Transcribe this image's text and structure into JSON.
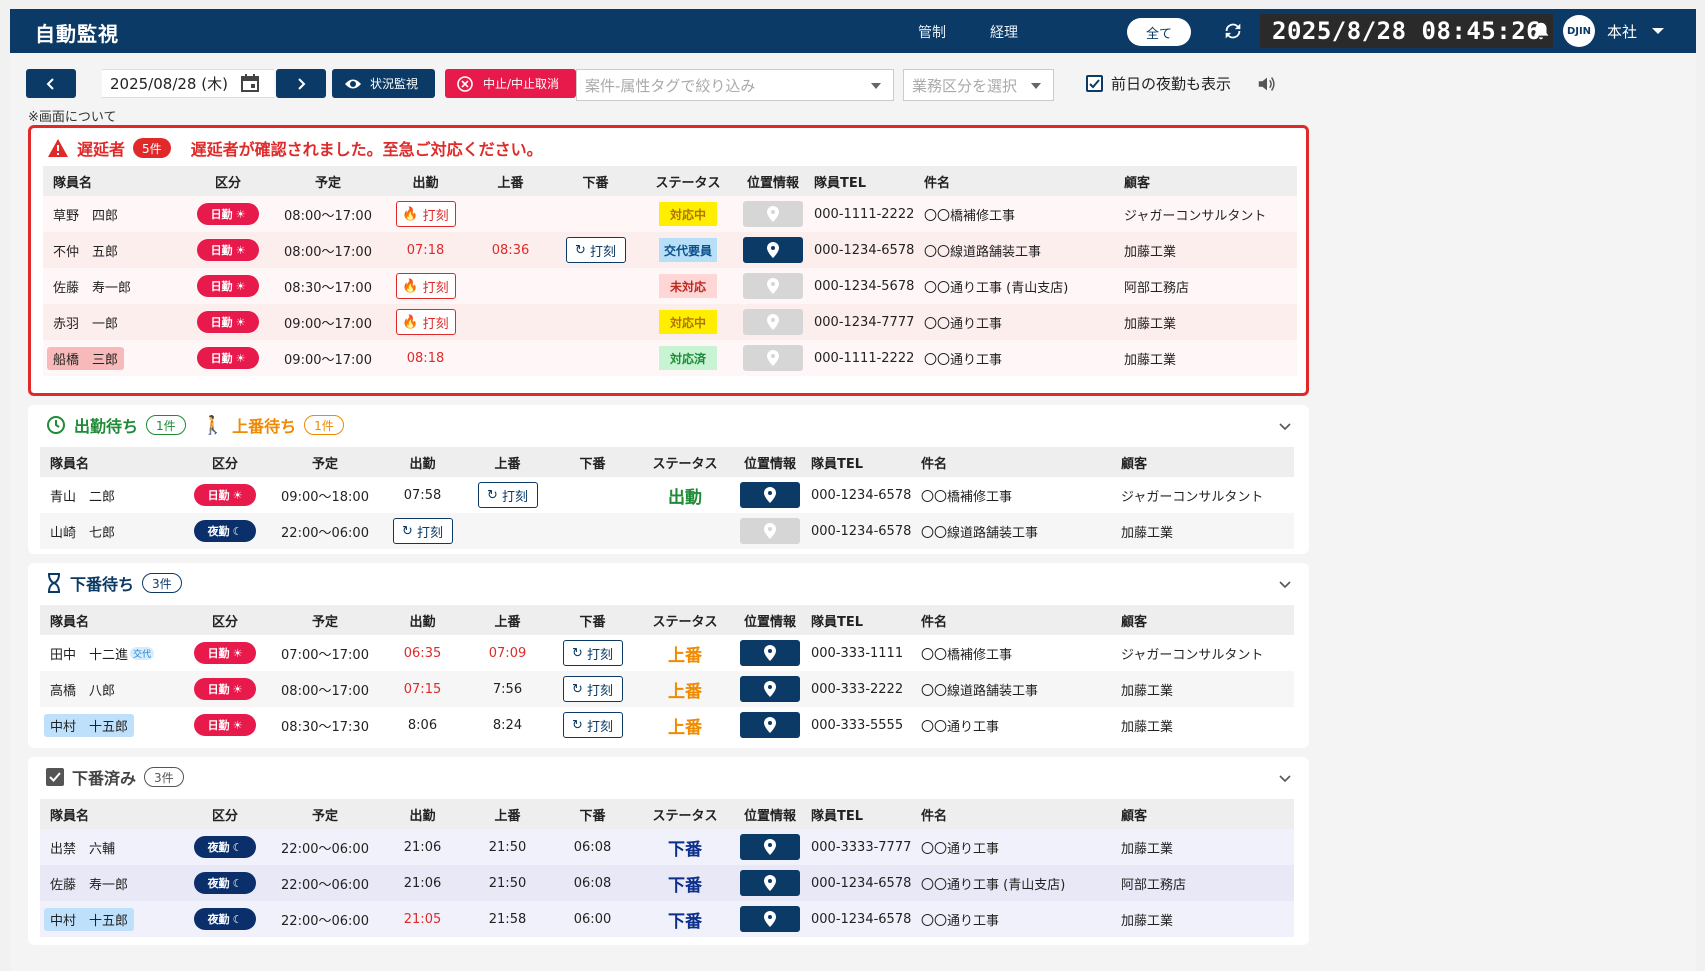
{
  "header": {
    "title": "自動監視",
    "links": [
      "管制",
      "経理"
    ],
    "scope": "全て",
    "clock": "2025/8/28 08:45:26",
    "avatar": "DJIN",
    "office": "本社"
  },
  "toolbar": {
    "date": "2025/08/28 (木)",
    "watch_label": "状況監視",
    "stop_label": "中止/中止取消",
    "tag_placeholder": "案件-属性タグで絞り込み",
    "biz_placeholder": "業務区分を選択",
    "prev_night_label": "前日の夜勤も表示",
    "note": "※画面について"
  },
  "columns": [
    "隊員名",
    "区分",
    "予定",
    "出勤",
    "上番",
    "下番",
    "ステータス",
    "位置情報",
    "隊員TEL",
    "件名",
    "顧客"
  ],
  "late": {
    "title": "遅延者",
    "count": "5件",
    "message": "遅延者が確認されました。至急ご対応ください。",
    "rows": [
      {
        "name": "草野　四郎",
        "kbn": "日勤",
        "plan": "08:00〜17:00",
        "in": "",
        "on": "",
        "off": "",
        "punch_col": "in",
        "punch": "打刻",
        "status": "対応中",
        "tel": "000-1111-2222",
        "case": "〇〇橋補修工事",
        "cust": "ジャガーコンサルタント"
      },
      {
        "name": "不仲　五郎",
        "kbn": "日勤",
        "plan": "08:00〜17:00",
        "in": "07:18",
        "on": "08:36",
        "off": "",
        "punch_col": "off",
        "punch": "打刻",
        "status": "交代要員",
        "tel": "000-1234-6578",
        "case": "〇〇線道路舗装工事",
        "cust": "加藤工業"
      },
      {
        "name": "佐藤　寿一郎",
        "kbn": "日勤",
        "plan": "08:30〜17:00",
        "in": "",
        "on": "",
        "off": "",
        "punch_col": "in",
        "punch": "打刻",
        "status": "未対応",
        "tel": "000-1234-5678",
        "case": "〇〇通り工事 (青山支店)",
        "cust": "阿部工務店"
      },
      {
        "name": "赤羽　一郎",
        "kbn": "日勤",
        "plan": "09:00〜17:00",
        "in": "",
        "on": "",
        "off": "",
        "punch_col": "in",
        "punch": "打刻",
        "status": "対応中",
        "tel": "000-1234-7777",
        "case": "〇〇通り工事",
        "cust": "加藤工業"
      },
      {
        "name": "船橋　三郎",
        "kbn": "日勤",
        "plan": "09:00〜17:00",
        "in": "08:18",
        "on": "",
        "off": "",
        "punch_col": "",
        "punch": "",
        "status": "対応済",
        "tel": "000-1111-2222",
        "case": "〇〇通り工事",
        "cust": "加藤工業"
      }
    ]
  },
  "waiting": {
    "title_in": "出勤待ち",
    "count_in": "1件",
    "title_on": "上番待ち",
    "count_on": "1件",
    "rows": [
      {
        "name": "青山　二郎",
        "kbn": "日勤",
        "plan": "09:00〜18:00",
        "in": "07:58",
        "punch": "打刻",
        "status": "出動",
        "tel": "000-1234-6578",
        "case": "〇〇橋補修工事",
        "cust": "ジャガーコンサルタント"
      },
      {
        "name": "山崎　七郎",
        "kbn": "夜勤",
        "plan": "22:00〜06:00",
        "punch": "打刻",
        "status": "",
        "tel": "000-1234-6578",
        "case": "〇〇線道路舗装工事",
        "cust": "加藤工業"
      }
    ]
  },
  "off_wait": {
    "title": "下番待ち",
    "count": "3件",
    "swap_tag": "交代",
    "rows": [
      {
        "name": "田中　十二進",
        "kbn": "日勤",
        "plan": "07:00〜17:00",
        "in": "06:35",
        "on": "07:09",
        "punch": "打刻",
        "status": "上番",
        "tel": "000-333-1111",
        "case": "〇〇橋補修工事",
        "cust": "ジャガーコンサルタント"
      },
      {
        "name": "高橋　八郎",
        "kbn": "日勤",
        "plan": "08:00〜17:00",
        "in": "07:15",
        "on": "7:56",
        "punch": "打刻",
        "status": "上番",
        "tel": "000-333-2222",
        "case": "〇〇線道路舗装工事",
        "cust": "加藤工業"
      },
      {
        "name": "中村　十五郎",
        "kbn": "日勤",
        "plan": "08:30〜17:30",
        "in": "8:06",
        "on": "8:24",
        "punch": "打刻",
        "status": "上番",
        "tel": "000-333-5555",
        "case": "〇〇通り工事",
        "cust": "加藤工業"
      }
    ]
  },
  "done": {
    "title": "下番済み",
    "count": "3件",
    "rows": [
      {
        "name": "出禁　六輔",
        "kbn": "夜勤",
        "plan": "22:00〜06:00",
        "in": "21:06",
        "on": "21:50",
        "off": "06:08",
        "status": "下番",
        "tel": "000-3333-7777",
        "case": "〇〇通り工事",
        "cust": "加藤工業"
      },
      {
        "name": "佐藤　寿一郎",
        "kbn": "夜勤",
        "plan": "22:00〜06:00",
        "in": "21:06",
        "on": "21:50",
        "off": "06:08",
        "status": "下番",
        "tel": "000-1234-6578",
        "case": "〇〇通り工事 (青山支店)",
        "cust": "阿部工務店"
      },
      {
        "name": "中村　十五郎",
        "kbn": "夜勤",
        "plan": "22:00〜06:00",
        "in": "21:05",
        "on": "21:58",
        "off": "06:00",
        "status": "下番",
        "tel": "000-1234-6578",
        "case": "〇〇通り工事",
        "cust": "加藤工業"
      }
    ]
  },
  "colors": {
    "navy": "#0b3a66",
    "alert_red": "#e02a2a",
    "day": "#e8194b",
    "night": "#0b2f6b",
    "onduty": "#f08a00",
    "start": "#1e8b36"
  }
}
